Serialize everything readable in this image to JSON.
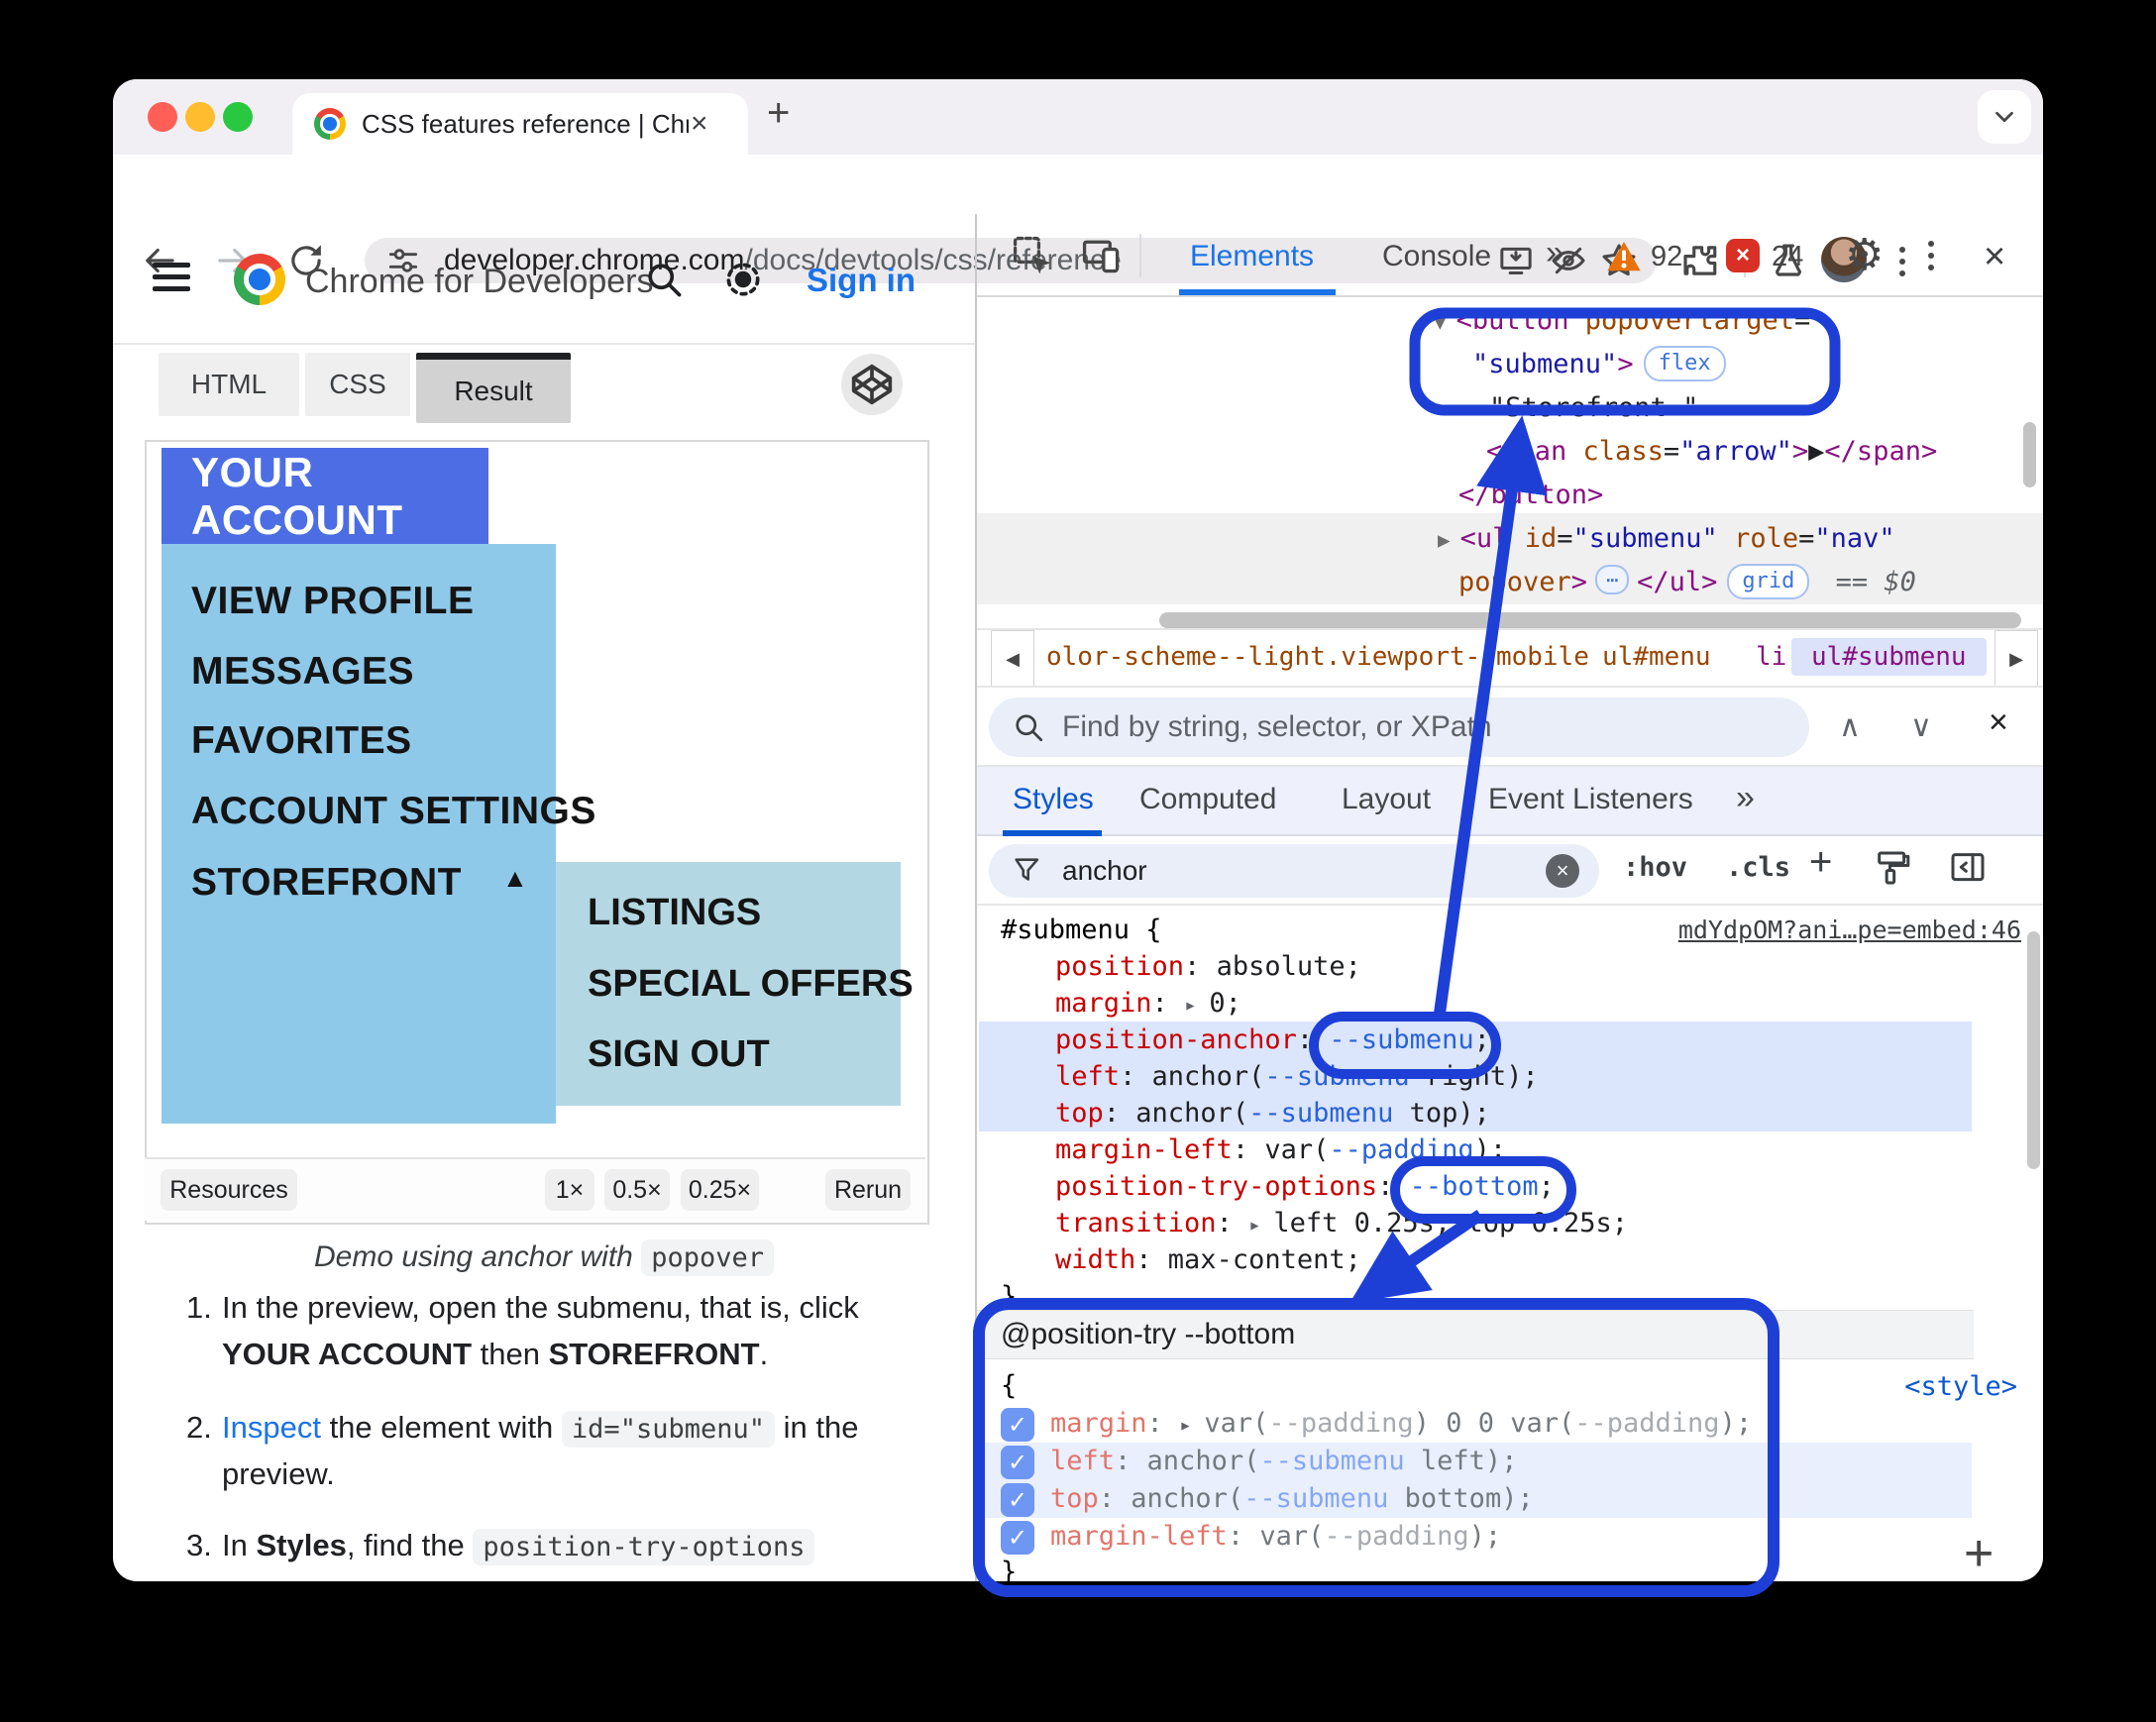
{
  "colors": {
    "annotation_blue": "#1e3fd6",
    "account_bg": "#4c6de3",
    "submenu_bg": "#8fc9e9",
    "subsubmenu_bg": "#b4d8e3",
    "accent_link": "#1a73e8",
    "devtools_active_tab": "#1a73e8",
    "warning_orange": "#e8710a",
    "error_red": "#d93025"
  },
  "icons": {
    "close": "×",
    "plus": "+",
    "gear": "⚙",
    "up": "∧",
    "down": "∨",
    "left_arrow": "◀",
    "right_arrow": "▶",
    "check": "✓",
    "expand_up": "▲",
    "add": "+"
  },
  "window": {
    "tab_title": "CSS features reference  |  Chr"
  },
  "urlbar": {
    "domain": "developer.chrome.com",
    "path": "/docs/devtools/css/reference"
  },
  "docs": {
    "brand": "Chrome for Developers",
    "sign_in": "Sign in",
    "tabs": {
      "html": "HTML",
      "css": "CSS",
      "result": "Result"
    },
    "demo": {
      "account": "YOUR ACCOUNT",
      "items": [
        "VIEW PROFILE",
        "MESSAGES",
        "FAVORITES",
        "ACCOUNT SETTINGS",
        "STOREFRONT"
      ],
      "subitems": [
        "LISTINGS",
        "SPECIAL OFFERS",
        "SIGN OUT"
      ]
    },
    "resources": {
      "label": "Resources",
      "scale1": "1×",
      "scale05": "0.5×",
      "scale025": "0.25×",
      "rerun": "Rerun"
    },
    "caption": [
      {
        "c": "cap",
        "t": "Demo using anchor with "
      },
      {
        "c": "code",
        "t": "popover"
      }
    ],
    "steps": {
      "n1": "1.",
      "n2": "2.",
      "n3": "3.",
      "s1l1": [
        {
          "c": "plain",
          "t": "In the preview, open the submenu, that is, click"
        }
      ],
      "s1l2": [
        {
          "c": "b",
          "t": "YOUR ACCOUNT"
        },
        {
          "c": "plain",
          "t": " then "
        },
        {
          "c": "b",
          "t": "STOREFRONT"
        },
        {
          "c": "plain",
          "t": "."
        }
      ],
      "s2l1": [
        {
          "c": "link",
          "t": "Inspect"
        },
        {
          "c": "plain",
          "t": " the element with "
        },
        {
          "c": "code",
          "t": "id=\"submenu\""
        },
        {
          "c": "plain",
          "t": " in the"
        }
      ],
      "s2l2": [
        {
          "c": "plain",
          "t": "preview."
        }
      ],
      "s3l1": [
        {
          "c": "plain",
          "t": "In "
        },
        {
          "c": "b",
          "t": "Styles"
        },
        {
          "c": "plain",
          "t": ", find the "
        },
        {
          "c": "code",
          "t": "position-try-options"
        }
      ]
    }
  },
  "devtools": {
    "tabs": {
      "elements": "Elements",
      "console": "Console",
      "more": "»"
    },
    "warning_count": "92",
    "error_count": "24",
    "tree": {
      "rows": {
        "r1": [
          {
            "c": "twisty",
            "t": "▼"
          },
          {
            "c": "tag",
            "t": "<button"
          },
          {
            "c": "txt",
            "t": " "
          },
          {
            "c": "attr",
            "t": "popovertarget"
          },
          {
            "c": "txt",
            "t": "="
          }
        ],
        "r2": [
          {
            "c": "str",
            "t": "\"submenu\""
          },
          {
            "c": "tag",
            "t": ">"
          },
          {
            "c": "badge",
            "t": "flex"
          }
        ],
        "r3": [
          {
            "c": "txt",
            "t": "\"Storefront \""
          }
        ],
        "r4": [
          {
            "c": "tag",
            "t": "<span"
          },
          {
            "c": "txt",
            "t": " "
          },
          {
            "c": "attr",
            "t": "class"
          },
          {
            "c": "txt",
            "t": "="
          },
          {
            "c": "str",
            "t": "\"arrow\""
          },
          {
            "c": "tag",
            "t": ">"
          },
          {
            "c": "txt",
            "t": "▶"
          },
          {
            "c": "tag",
            "t": "</span>"
          }
        ],
        "r5": [
          {
            "c": "tag",
            "t": "</button>"
          }
        ],
        "r6": [
          {
            "c": "twisty",
            "t": "▶"
          },
          {
            "c": "tag",
            "t": "<ul"
          },
          {
            "c": "txt",
            "t": " "
          },
          {
            "c": "attr",
            "t": "id"
          },
          {
            "c": "txt",
            "t": "="
          },
          {
            "c": "str",
            "t": "\"submenu\""
          },
          {
            "c": "txt",
            "t": " "
          },
          {
            "c": "attr",
            "t": "role"
          },
          {
            "c": "txt",
            "t": "="
          },
          {
            "c": "str",
            "t": "\"nav\""
          }
        ],
        "r7": [
          {
            "c": "attr",
            "t": "popover"
          },
          {
            "c": "tag",
            "t": ">"
          },
          {
            "c": "dots",
            "t": "⋯"
          },
          {
            "c": "tag",
            "t": "</ul>"
          },
          {
            "c": "badge",
            "t": "grid"
          },
          {
            "c": "eq",
            "t": " == "
          },
          {
            "c": "dollar",
            "t": "$0"
          }
        ]
      }
    },
    "breadcrumbs": {
      "c1": "olor-scheme--light.viewport--mobile",
      "c2": "ul#menu",
      "c3": "li",
      "c4": "ul#submenu"
    },
    "find": {
      "placeholder": "Find by string, selector, or XPath"
    },
    "panel_tabs": {
      "styles": "Styles",
      "computed": "Computed",
      "layout": "Layout",
      "events": "Event Listeners",
      "more": "»"
    },
    "filter": {
      "value": "anchor",
      "hov": ":hov",
      "cls": ".cls"
    },
    "rule1": {
      "selector": "#submenu {",
      "close": "}",
      "source": "mdYdpOM?ani…pe=embed:46",
      "d0": [
        {
          "c": "prop",
          "t": "position"
        },
        {
          "c": "pn",
          "t": ": "
        },
        {
          "c": "val",
          "t": "absolute;"
        }
      ],
      "d1": [
        {
          "c": "prop",
          "t": "margin"
        },
        {
          "c": "pn",
          "t": ": "
        },
        {
          "c": "tri",
          "t": "▸ "
        },
        {
          "c": "val",
          "t": "0;"
        }
      ],
      "d2": [
        {
          "c": "prop",
          "t": "position-anchor"
        },
        {
          "c": "pn",
          "t": ": "
        },
        {
          "c": "var",
          "t": "--submenu"
        },
        {
          "c": "val",
          "t": ";"
        }
      ],
      "d3": [
        {
          "c": "prop",
          "t": "left"
        },
        {
          "c": "pn",
          "t": ": "
        },
        {
          "c": "val",
          "t": "anchor("
        },
        {
          "c": "var",
          "t": "--submenu"
        },
        {
          "c": "val",
          "t": " right);"
        }
      ],
      "d4": [
        {
          "c": "prop",
          "t": "top"
        },
        {
          "c": "pn",
          "t": ": "
        },
        {
          "c": "val",
          "t": "anchor("
        },
        {
          "c": "var",
          "t": "--submenu"
        },
        {
          "c": "val",
          "t": " top);"
        }
      ],
      "d5": [
        {
          "c": "prop",
          "t": "margin-left"
        },
        {
          "c": "pn",
          "t": ": "
        },
        {
          "c": "val",
          "t": "var("
        },
        {
          "c": "var",
          "t": "--padding"
        },
        {
          "c": "val",
          "t": ");"
        }
      ],
      "d6": [
        {
          "c": "prop",
          "t": "position-try-options"
        },
        {
          "c": "pn",
          "t": ": "
        },
        {
          "c": "var",
          "t": "--bottom"
        },
        {
          "c": "val",
          "t": ";"
        }
      ],
      "d7": [
        {
          "c": "prop",
          "t": "transition"
        },
        {
          "c": "pn",
          "t": ": "
        },
        {
          "c": "tri",
          "t": "▸ "
        },
        {
          "c": "val",
          "t": "left 0.25s, top 0.25s;"
        }
      ],
      "d8": [
        {
          "c": "prop",
          "t": "width"
        },
        {
          "c": "pn",
          "t": ": "
        },
        {
          "c": "val",
          "t": "max-content;"
        }
      ]
    },
    "attry": {
      "header": "@position-try --bottom",
      "open": "{",
      "close": "}",
      "source": "<style>",
      "d0": [
        {
          "c": "prop2",
          "t": "margin"
        },
        {
          "c": "pn2",
          "t": ": "
        },
        {
          "c": "tri",
          "t": "▸ "
        },
        {
          "c": "val2",
          "t": "var("
        },
        {
          "c": "var2g",
          "t": "--padding"
        },
        {
          "c": "val2",
          "t": ") 0 0 var("
        },
        {
          "c": "var2g",
          "t": "--padding"
        },
        {
          "c": "val2",
          "t": ");"
        }
      ],
      "d1": [
        {
          "c": "prop2",
          "t": "left"
        },
        {
          "c": "pn2",
          "t": ": "
        },
        {
          "c": "val2",
          "t": "anchor("
        },
        {
          "c": "var2b",
          "t": "--submenu"
        },
        {
          "c": "val2",
          "t": " left);"
        }
      ],
      "d2": [
        {
          "c": "prop2",
          "t": "top"
        },
        {
          "c": "pn2",
          "t": ": "
        },
        {
          "c": "val2",
          "t": "anchor("
        },
        {
          "c": "var2b",
          "t": "--submenu"
        },
        {
          "c": "val2",
          "t": " bottom);"
        }
      ],
      "d3": [
        {
          "c": "prop2",
          "t": "margin-left"
        },
        {
          "c": "pn2",
          "t": ": "
        },
        {
          "c": "val2",
          "t": "var("
        },
        {
          "c": "var2g",
          "t": "--padding"
        },
        {
          "c": "val2",
          "t": ");"
        }
      ]
    }
  }
}
